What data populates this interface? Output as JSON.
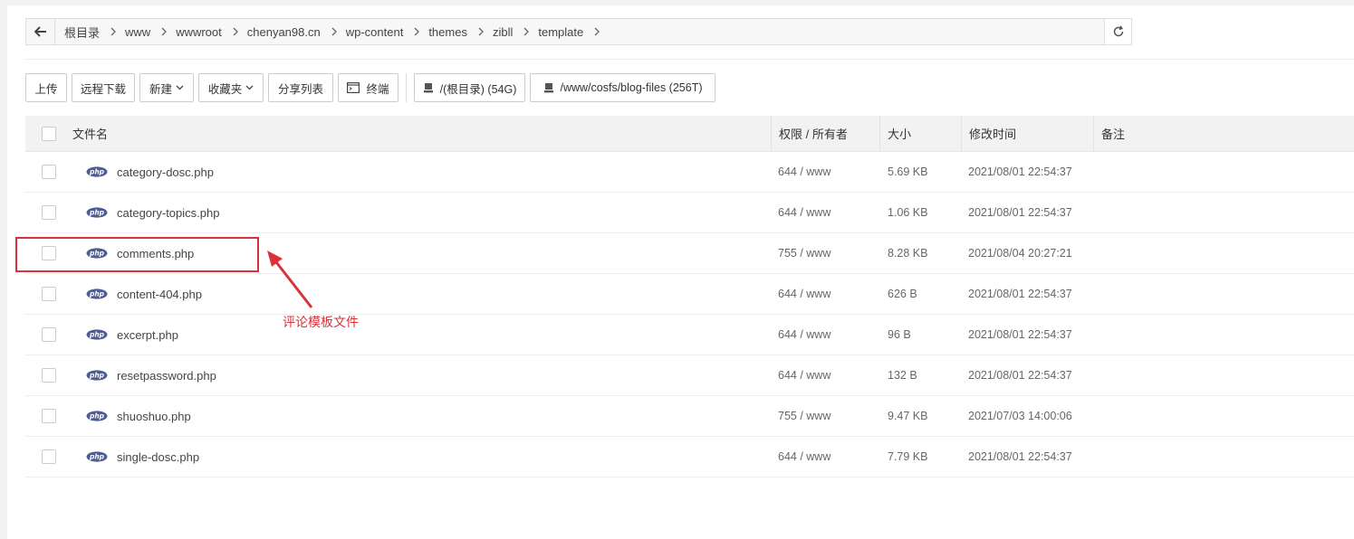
{
  "breadcrumb": [
    "根目录",
    "www",
    "wwwroot",
    "chenyan98.cn",
    "wp-content",
    "themes",
    "zibll",
    "template"
  ],
  "toolbar": {
    "upload": "上传",
    "remote_download": "远程下载",
    "new": "新建",
    "favorites": "收藏夹",
    "share_list": "分享列表",
    "terminal": "终端",
    "disks": [
      "/(根目录) (54G)",
      "/www/cosfs/blog-files (256T)"
    ]
  },
  "table": {
    "headers": {
      "name": "文件名",
      "perm": "权限 / 所有者",
      "size": "大小",
      "time": "修改时间",
      "note": "备注"
    },
    "rows": [
      {
        "name": "category-dosc.php",
        "perm": "644 / www",
        "size": "5.69 KB",
        "time": "2021/08/01 22:54:37"
      },
      {
        "name": "category-topics.php",
        "perm": "644 / www",
        "size": "1.06 KB",
        "time": "2021/08/01 22:54:37"
      },
      {
        "name": "comments.php",
        "perm": "755 / www",
        "size": "8.28 KB",
        "time": "2021/08/04 20:27:21"
      },
      {
        "name": "content-404.php",
        "perm": "644 / www",
        "size": "626 B",
        "time": "2021/08/01 22:54:37"
      },
      {
        "name": "excerpt.php",
        "perm": "644 / www",
        "size": "96 B",
        "time": "2021/08/01 22:54:37"
      },
      {
        "name": "resetpassword.php",
        "perm": "644 / www",
        "size": "132 B",
        "time": "2021/08/01 22:54:37"
      },
      {
        "name": "shuoshuo.php",
        "perm": "755 / www",
        "size": "9.47 KB",
        "time": "2021/07/03 14:00:06"
      },
      {
        "name": "single-dosc.php",
        "perm": "644 / www",
        "size": "7.79 KB",
        "time": "2021/08/01 22:54:37"
      }
    ]
  },
  "annotation": {
    "text": "评论模板文件",
    "color": "#d9333a"
  },
  "icons": {
    "file_type": "php-file-icon",
    "php_label": "php"
  }
}
